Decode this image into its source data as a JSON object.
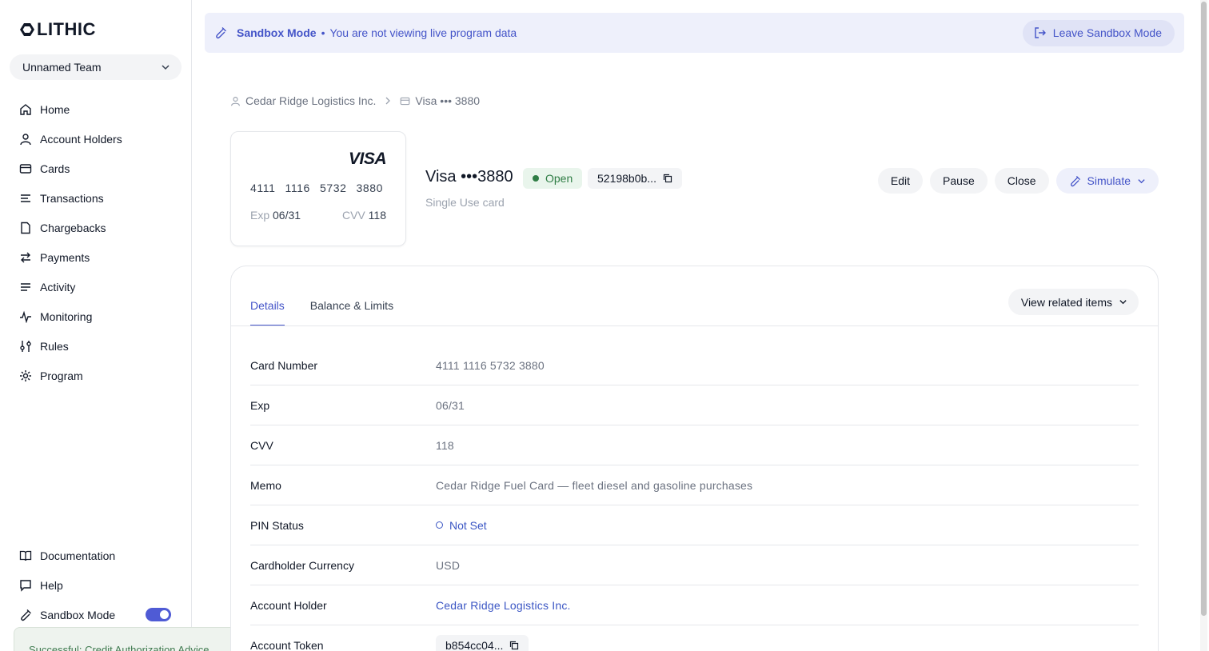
{
  "app": {
    "logo_text": "LITHIC"
  },
  "sidebar": {
    "team": "Unnamed Team",
    "items": [
      {
        "label": "Home",
        "icon": "home-icon"
      },
      {
        "label": "Account Holders",
        "icon": "user-icon"
      },
      {
        "label": "Cards",
        "icon": "card-icon"
      },
      {
        "label": "Transactions",
        "icon": "list-icon"
      },
      {
        "label": "Chargebacks",
        "icon": "file-icon"
      },
      {
        "label": "Payments",
        "icon": "arrows-icon"
      },
      {
        "label": "Activity",
        "icon": "activity-list-icon"
      },
      {
        "label": "Monitoring",
        "icon": "pulse-icon"
      },
      {
        "label": "Rules",
        "icon": "sliders-icon"
      },
      {
        "label": "Program",
        "icon": "gear-icon"
      }
    ],
    "bottom": {
      "documentation": "Documentation",
      "help": "Help",
      "sandbox_mode": "Sandbox Mode",
      "sandbox_enabled": true
    },
    "toast": "Successful: Credit Authorization Advice"
  },
  "banner": {
    "mode": "Sandbox Mode",
    "separator": "•",
    "message": "You are not viewing live program data",
    "leave_button": "Leave Sandbox Mode"
  },
  "breadcrumb": {
    "account_holder": "Cedar Ridge Logistics Inc.",
    "card": "Visa ••• 3880"
  },
  "card_visual": {
    "brand": "VISA",
    "number_groups": [
      "4111",
      "1116",
      "5732",
      "3880"
    ],
    "exp_label": "Exp",
    "exp_value": "06/31",
    "cvv_label": "CVV",
    "cvv_value": "118"
  },
  "card_header": {
    "title": "Visa •••3880",
    "status": "Open",
    "token": "52198b0b...",
    "subtitle": "Single Use card"
  },
  "actions": {
    "edit": "Edit",
    "pause": "Pause",
    "close": "Close",
    "simulate": "Simulate"
  },
  "tabs": {
    "details": "Details",
    "balance": "Balance & Limits",
    "related": "View related items"
  },
  "details": {
    "card_number": {
      "label": "Card Number",
      "value": "4111 1116 5732 3880"
    },
    "exp": {
      "label": "Exp",
      "value": "06/31"
    },
    "cvv": {
      "label": "CVV",
      "value": "118"
    },
    "memo": {
      "label": "Memo",
      "value": "Cedar Ridge Fuel Card — fleet diesel and gasoline purchases"
    },
    "pin_status": {
      "label": "PIN Status",
      "value": "Not Set"
    },
    "currency": {
      "label": "Cardholder Currency",
      "value": "USD"
    },
    "account_holder": {
      "label": "Account Holder",
      "value": "Cedar Ridge Logistics Inc."
    },
    "account_token": {
      "label": "Account Token",
      "value": "b854cc04..."
    }
  },
  "colors": {
    "accent": "#4454c8",
    "open_green": "#2f7d45",
    "link": "#3b56c4"
  }
}
